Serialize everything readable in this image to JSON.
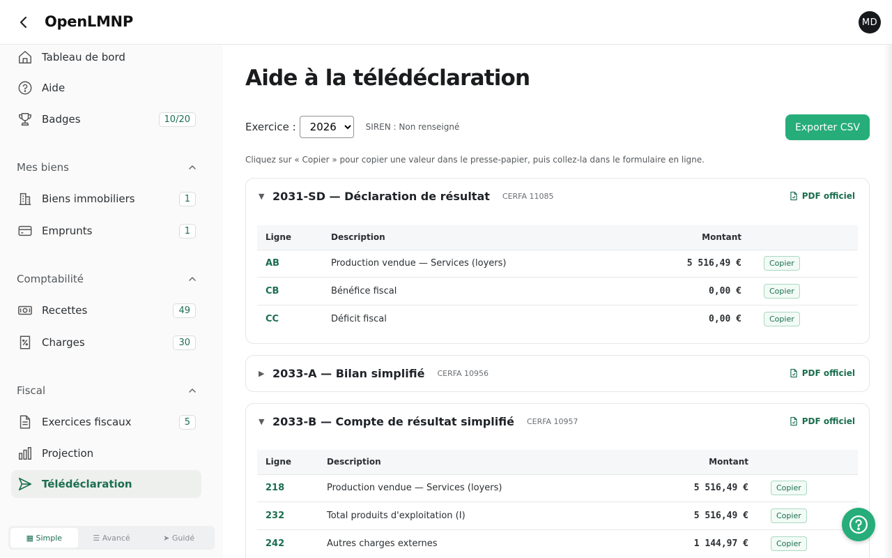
{
  "header": {
    "app_title": "OpenLMNP",
    "avatar_initials": "MD"
  },
  "sidebar": {
    "top_items": [
      {
        "label": "Tableau de bord",
        "icon": "home-icon"
      },
      {
        "label": "Aide",
        "icon": "help-circle-icon"
      },
      {
        "label": "Badges",
        "icon": "trophy-icon",
        "badge": "10/20"
      }
    ],
    "sections": [
      {
        "label": "Mes biens",
        "items": [
          {
            "label": "Biens immobiliers",
            "icon": "building-icon",
            "badge": "1"
          },
          {
            "label": "Emprunts",
            "icon": "credit-card-icon",
            "badge": "1"
          }
        ]
      },
      {
        "label": "Comptabilité",
        "items": [
          {
            "label": "Recettes",
            "icon": "banknote-icon",
            "badge": "49"
          },
          {
            "label": "Charges",
            "icon": "percent-receipt-icon",
            "badge": "30"
          }
        ]
      },
      {
        "label": "Fiscal",
        "items": [
          {
            "label": "Exercices fiscaux",
            "icon": "document-icon",
            "badge": "5"
          },
          {
            "label": "Projection",
            "icon": "bar-chart-icon"
          },
          {
            "label": "Télédéclaration",
            "icon": "send-icon",
            "active": true
          }
        ]
      }
    ],
    "mode_switch": [
      {
        "label": "▦ Simple",
        "active": true
      },
      {
        "label": "☰ Avancé"
      },
      {
        "label": "➤ Guidé"
      }
    ]
  },
  "main": {
    "title": "Aide à la télédéclaration",
    "exercise_label": "Exercice :",
    "exercise_value": "2026",
    "siren": "SIREN : Non renseigné",
    "export_label": "Exporter CSV",
    "hint": "Cliquez sur « Copier » pour copier une valeur dans le presse-papier, puis collez-la dans le formulaire en ligne.",
    "cards": [
      {
        "title": "2031-SD — Déclaration de résultat",
        "cerfa": "CERFA 11085",
        "pdf_label": "PDF officiel",
        "expanded": true,
        "columns": [
          "Ligne",
          "Description",
          "Montant"
        ],
        "rows": [
          {
            "code": "AB",
            "desc": "Production vendue — Services (loyers)",
            "amount": "5 516,49 €"
          },
          {
            "code": "CB",
            "desc": "Bénéfice fiscal",
            "amount": "0,00 €"
          },
          {
            "code": "CC",
            "desc": "Déficit fiscal",
            "amount": "0,00 €"
          }
        ]
      },
      {
        "title": "2033-A — Bilan simplifié",
        "cerfa": "CERFA 10956",
        "pdf_label": "PDF officiel",
        "expanded": false
      },
      {
        "title": "2033-B — Compte de résultat simplifié",
        "cerfa": "CERFA 10957",
        "pdf_label": "PDF officiel",
        "expanded": true,
        "columns": [
          "Ligne",
          "Description",
          "Montant"
        ],
        "rows": [
          {
            "code": "218",
            "desc": "Production vendue — Services (loyers)",
            "amount": "5 516,49 €"
          },
          {
            "code": "232",
            "desc": "Total produits d'exploitation (I)",
            "amount": "5 516,49 €"
          },
          {
            "code": "242",
            "desc": "Autres charges externes",
            "amount": "1 144,97 €"
          }
        ]
      }
    ],
    "copy_label": "Copier"
  },
  "colors": {
    "accent": "#26ad7a",
    "accent_dark": "#1b6e4f"
  }
}
